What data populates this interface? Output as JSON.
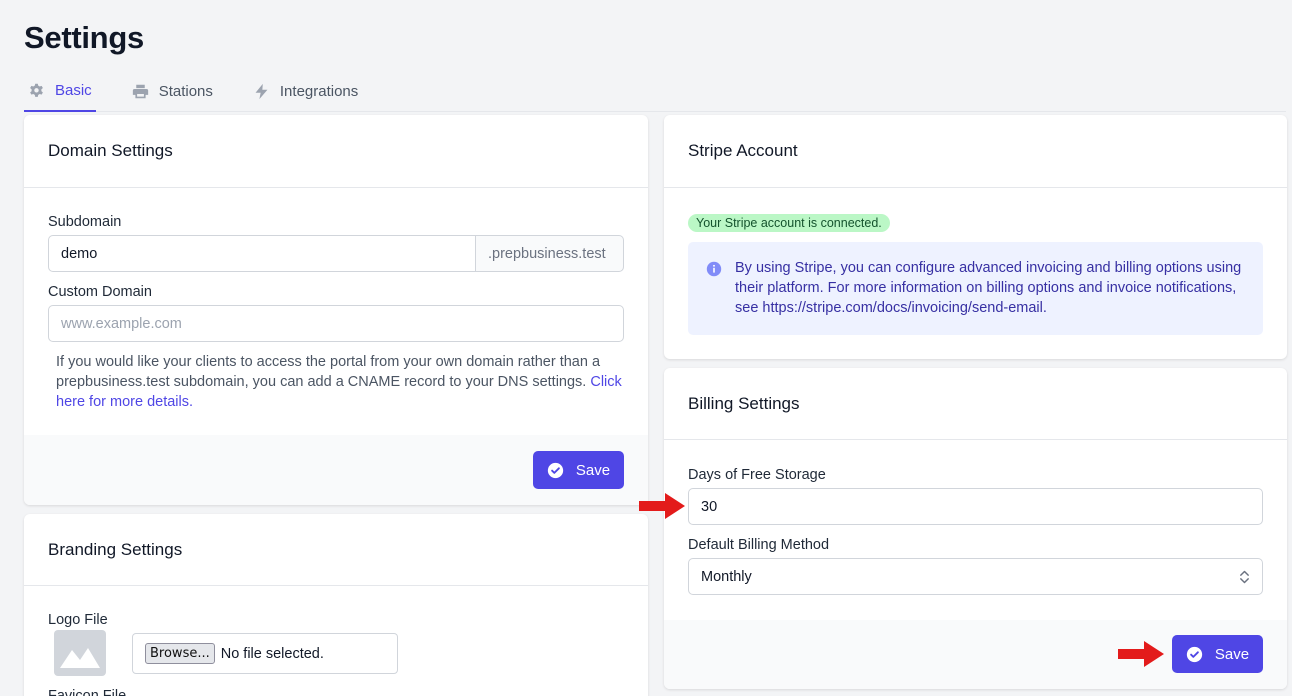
{
  "page": {
    "title": "Settings"
  },
  "tabs": [
    {
      "label": "Basic",
      "icon": "gear-icon",
      "active": true
    },
    {
      "label": "Stations",
      "icon": "printer-icon",
      "active": false
    },
    {
      "label": "Integrations",
      "icon": "lightning-icon",
      "active": false
    }
  ],
  "domain_settings": {
    "title": "Domain Settings",
    "subdomain_label": "Subdomain",
    "subdomain_value": "demo",
    "subdomain_suffix": ".prepbusiness.test",
    "custom_domain_label": "Custom Domain",
    "custom_domain_placeholder": "www.example.com",
    "help_text": "If you would like your clients to access the portal from your own domain rather than a prepbusiness.test subdomain, you can add a CNAME record to your DNS settings.",
    "help_link": "Click here for more details.",
    "save_label": "Save"
  },
  "branding_settings": {
    "title": "Branding Settings",
    "logo_label": "Logo File",
    "browse_label": "Browse...",
    "file_status": "No file selected.",
    "favicon_label": "Favicon File"
  },
  "stripe_account": {
    "title": "Stripe Account",
    "status_badge": "Your Stripe account is connected.",
    "info_text": "By using Stripe, you can configure advanced invoicing and billing options using their platform. For more information on billing options and invoice notifications, see https://stripe.com/docs/invoicing/send-email."
  },
  "billing_settings": {
    "title": "Billing Settings",
    "free_storage_label": "Days of Free Storage",
    "free_storage_value": "30",
    "billing_method_label": "Default Billing Method",
    "billing_method_value": "Monthly",
    "save_label": "Save"
  },
  "colors": {
    "accent": "#4f46e5",
    "annotation_arrow": "#e31b1b",
    "badge_bg": "#bbf7c6",
    "info_bg": "#eef2ff"
  }
}
